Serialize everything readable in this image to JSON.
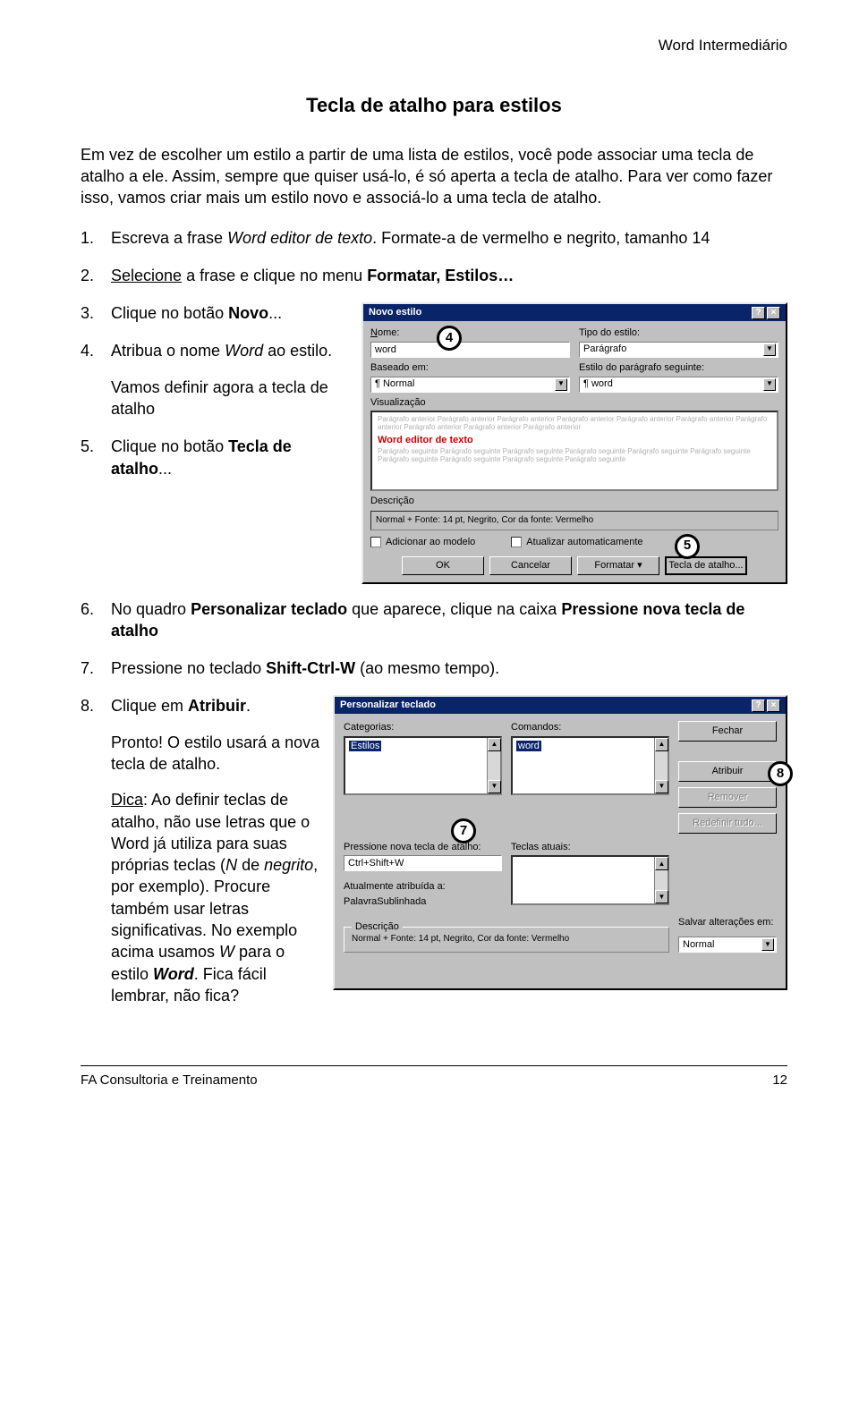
{
  "header_right": "Word Intermediário",
  "title": "Tecla de atalho para estilos",
  "intro": "Em vez de escolher um estilo a partir de uma lista de estilos, você pode associar uma tecla de atalho a ele. Assim, sempre que quiser usá-lo, é só aperta a tecla de atalho. Para ver como fazer isso, vamos criar mais um estilo novo e associá-lo a uma tecla de atalho.",
  "steps": {
    "n1": "1.",
    "s1a": "Escreva a frase ",
    "s1b": "Word editor de texto",
    "s1c": ". Formate-a de vermelho e negrito, tamanho 14",
    "n2": "2.",
    "s2a": "Selecione",
    "s2b": " a frase e clique no menu ",
    "s2c": "Formatar, Estilos…",
    "n3": "3.",
    "s3a": "Clique no botão ",
    "s3b": "Novo",
    "s3c": "...",
    "n4": "4.",
    "s4a": "Atribua o nome ",
    "s4b": "Word",
    "s4c": " ao estilo.",
    "s4d": "Vamos definir agora a tecla de atalho",
    "n5": "5.",
    "s5a": "Clique no botão ",
    "s5b": "Tecla de atalho",
    "s5c": "...",
    "n6": "6.",
    "s6a": "No quadro ",
    "s6b": "Personalizar teclado",
    "s6c": " que aparece, clique na caixa ",
    "s6d": "Pressione nova tecla de atalho",
    "n7": "7.",
    "s7a": "Pressione no teclado ",
    "s7b": "Shift-Ctrl-W",
    "s7c": " (ao mesmo tempo).",
    "n8": "8.",
    "s8a": "Clique em ",
    "s8b": "Atribuir",
    "s8c": ".",
    "s8d": "Pronto! O estilo usará a nova tecla de atalho.",
    "tip_a": "Dica",
    "tip_b": ": Ao definir teclas de atalho, não use letras que o Word já utiliza para suas próprias teclas (",
    "tip_c": "N",
    "tip_d": " de ",
    "tip_e": "negrito",
    "tip_f": ", por exemplo). Procure também usar letras significativas. No exemplo acima usamos ",
    "tip_g": "W",
    "tip_h": " para o estilo ",
    "tip_i": "Word",
    "tip_j": ". Fica fácil lembrar, não fica?"
  },
  "callouts": {
    "c4": "4",
    "c5": "5",
    "c7": "7",
    "c8": "8"
  },
  "dlg1": {
    "title": "Novo estilo",
    "help": "?",
    "close": "×",
    "lbl_nome": "Nome:",
    "val_nome": "word",
    "lbl_tipo": "Tipo do estilo:",
    "val_tipo": "Parágrafo",
    "lbl_baseado": "Baseado em:",
    "val_baseado": "¶ Normal",
    "lbl_seguinte": "Estilo do parágrafo seguinte:",
    "val_seguinte": "¶ word",
    "lbl_visualizacao": "Visualização",
    "preview_before": "Parágrafo anterior Parágrafo anterior Parágrafo anterior Parágrafo anterior Parágrafo anterior Parágrafo anterior Parágrafo anterior Parágrafo anterior Parágrafo anterior Parágrafo anterior",
    "preview_main": "Word editor de texto",
    "preview_after": "Parágrafo seguinte Parágrafo seguinte Parágrafo seguinte Parágrafo seguinte Parágrafo seguinte Parágrafo seguinte Parágrafo seguinte Parágrafo seguinte Parágrafo seguinte Parágrafo seguinte",
    "lbl_descricao": "Descrição",
    "val_descricao": "Normal + Fonte: 14 pt, Negrito, Cor da fonte: Vermelho",
    "chk_adicionar": "Adicionar ao modelo",
    "chk_atualizar": "Atualizar automaticamente",
    "btn_ok": "OK",
    "btn_cancelar": "Cancelar",
    "btn_formatar": "Formatar ▾",
    "btn_tecla": "Tecla de atalho..."
  },
  "dlg2": {
    "title": "Personalizar teclado",
    "help": "?",
    "close": "×",
    "lbl_categorias": "Categorias:",
    "val_cat": "Estilos",
    "lbl_comandos": "Comandos:",
    "val_cmd": "word",
    "btn_fechar": "Fechar",
    "btn_atribuir": "Atribuir",
    "btn_remover": "Remover",
    "btn_redefinir": "Redefinir tudo...",
    "lbl_nova": "Pressione nova tecla de atalho:",
    "val_nova": "Ctrl+Shift+W",
    "lbl_atuais": "Teclas atuais:",
    "lbl_atribuida": "Atualmente atribuída a:",
    "val_atribuida": "PalavraSublinhada",
    "lbl_desc": "Descrição",
    "val_desc": "Normal + Fonte: 14 pt, Negrito, Cor da fonte: Vermelho",
    "lbl_salvar": "Salvar alterações em:",
    "val_salvar": "Normal"
  },
  "footer": {
    "left": "FA Consultoria e Treinamento",
    "right": "12"
  }
}
